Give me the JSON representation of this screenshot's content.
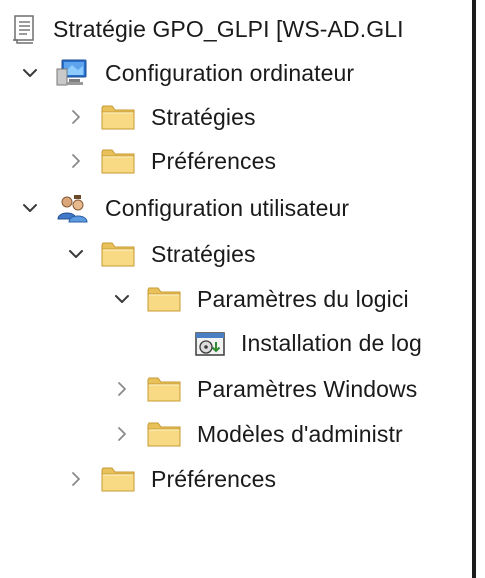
{
  "tree": {
    "root": {
      "label": "Stratégie GPO_GLPI [WS-AD.GLI",
      "icon": "policy-document-icon"
    },
    "computer_config": {
      "label": "Configuration ordinateur",
      "icon": "computer-icon",
      "expanded": true,
      "children": [
        {
          "label": "Stratégies",
          "icon": "folder-icon",
          "expanded": false
        },
        {
          "label": "Préférences",
          "icon": "folder-icon",
          "expanded": false
        }
      ]
    },
    "user_config": {
      "label": "Configuration utilisateur",
      "icon": "users-icon",
      "expanded": true,
      "policies": {
        "label": "Stratégies",
        "icon": "folder-icon",
        "expanded": true,
        "software_settings": {
          "label": "Paramètres du logici",
          "icon": "folder-icon",
          "expanded": true,
          "software_install": {
            "label": "Installation de log",
            "icon": "software-install-icon"
          }
        },
        "windows_settings": {
          "label": "Paramètres Windows",
          "icon": "folder-icon",
          "expanded": false
        },
        "admin_templates": {
          "label": "Modèles d'administr",
          "icon": "folder-icon",
          "expanded": false
        }
      },
      "preferences": {
        "label": "Préférences",
        "icon": "folder-icon",
        "expanded": false
      }
    }
  },
  "colors": {
    "background": "#ffffff",
    "folder_fill": "#f5d67a",
    "folder_edge": "#d9b24a",
    "chevron": "#8a8a8a",
    "divider": "#1c1c1c"
  }
}
